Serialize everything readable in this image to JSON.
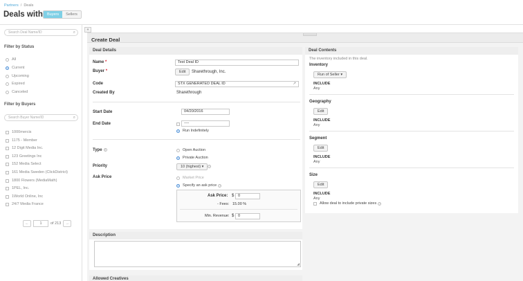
{
  "breadcrumb": {
    "root": "Partners",
    "current": "Deals"
  },
  "page_title": "Deals with",
  "toggle": {
    "buyers": "Buyers",
    "sellers": "Sellers"
  },
  "sidebar": {
    "search_deal_placeholder": "Search Deal Name/ID",
    "status_title": "Filter by Status",
    "statuses": [
      "All",
      "Current",
      "Upcoming",
      "Expired",
      "Canceled"
    ],
    "selected_status": "Current",
    "buyers_title": "Filter by Buyers",
    "search_buyer_placeholder": "Search Buyer Name/ID",
    "buyers": [
      "1000mercis",
      "1175 - Member",
      "12 Digit Media Inc.",
      "123 Greetings Inc",
      "152 Media Select",
      "161 Media Sweden (ClickDistrict)",
      "1800 Flowers (MediaMath)",
      "1PEL, Inc.",
      "1World Online, Inc",
      "24/7 Media France"
    ],
    "pager": {
      "prev": "←",
      "page": "1",
      "of": "of 213",
      "next": "→"
    }
  },
  "collapse_label": "«",
  "main": {
    "title": "Create Deal",
    "details": {
      "heading": "Deal Details",
      "name_label": "Name",
      "name_value": "Test Deal ID",
      "buyer_label": "Buyer",
      "buyer_edit": "Edit",
      "buyer_value": "Sharethrough, Inc.",
      "code_label": "Code",
      "code_value": "STX GENERATED DEAL ID",
      "code_icon": "↗",
      "created_by_label": "Created By",
      "created_by_value": "Sharethrough",
      "start_label": "Start Date",
      "start_value": "04/20/2016",
      "end_label": "End Date",
      "end_value": "----",
      "run_indef": "Run Indefinitely",
      "type_label": "Type",
      "type_open": "Open Auction",
      "type_private": "Private Auction",
      "priority_label": "Priority",
      "priority_value": "10 (highest) ▾",
      "ask_label": "Ask Price",
      "market_price": "Market Price",
      "specify_price": "Specify an ask price",
      "ask_price_label": "Ask Price:",
      "ask_price_value": "0",
      "fees_label": "- Fees:",
      "fees_value": "15.00 %",
      "min_rev_label": "Min. Revenue:",
      "min_rev_value": "0",
      "currency": "$",
      "required": "*",
      "help": "?"
    },
    "description_heading": "Description",
    "allowed_creatives_heading": "Allowed Creatives",
    "contents": {
      "heading": "Deal Contents",
      "subtitle": "The inventory included in this deal.",
      "inventory_title": "Inventory",
      "inventory_button": "Run of Seller ▾",
      "geography_title": "Geography",
      "segment_title": "Segment",
      "size_title": "Size",
      "edit": "Edit",
      "include": "INCLUDE",
      "any": "Any",
      "private_sizes": "Allow deal to include private sizes"
    }
  }
}
